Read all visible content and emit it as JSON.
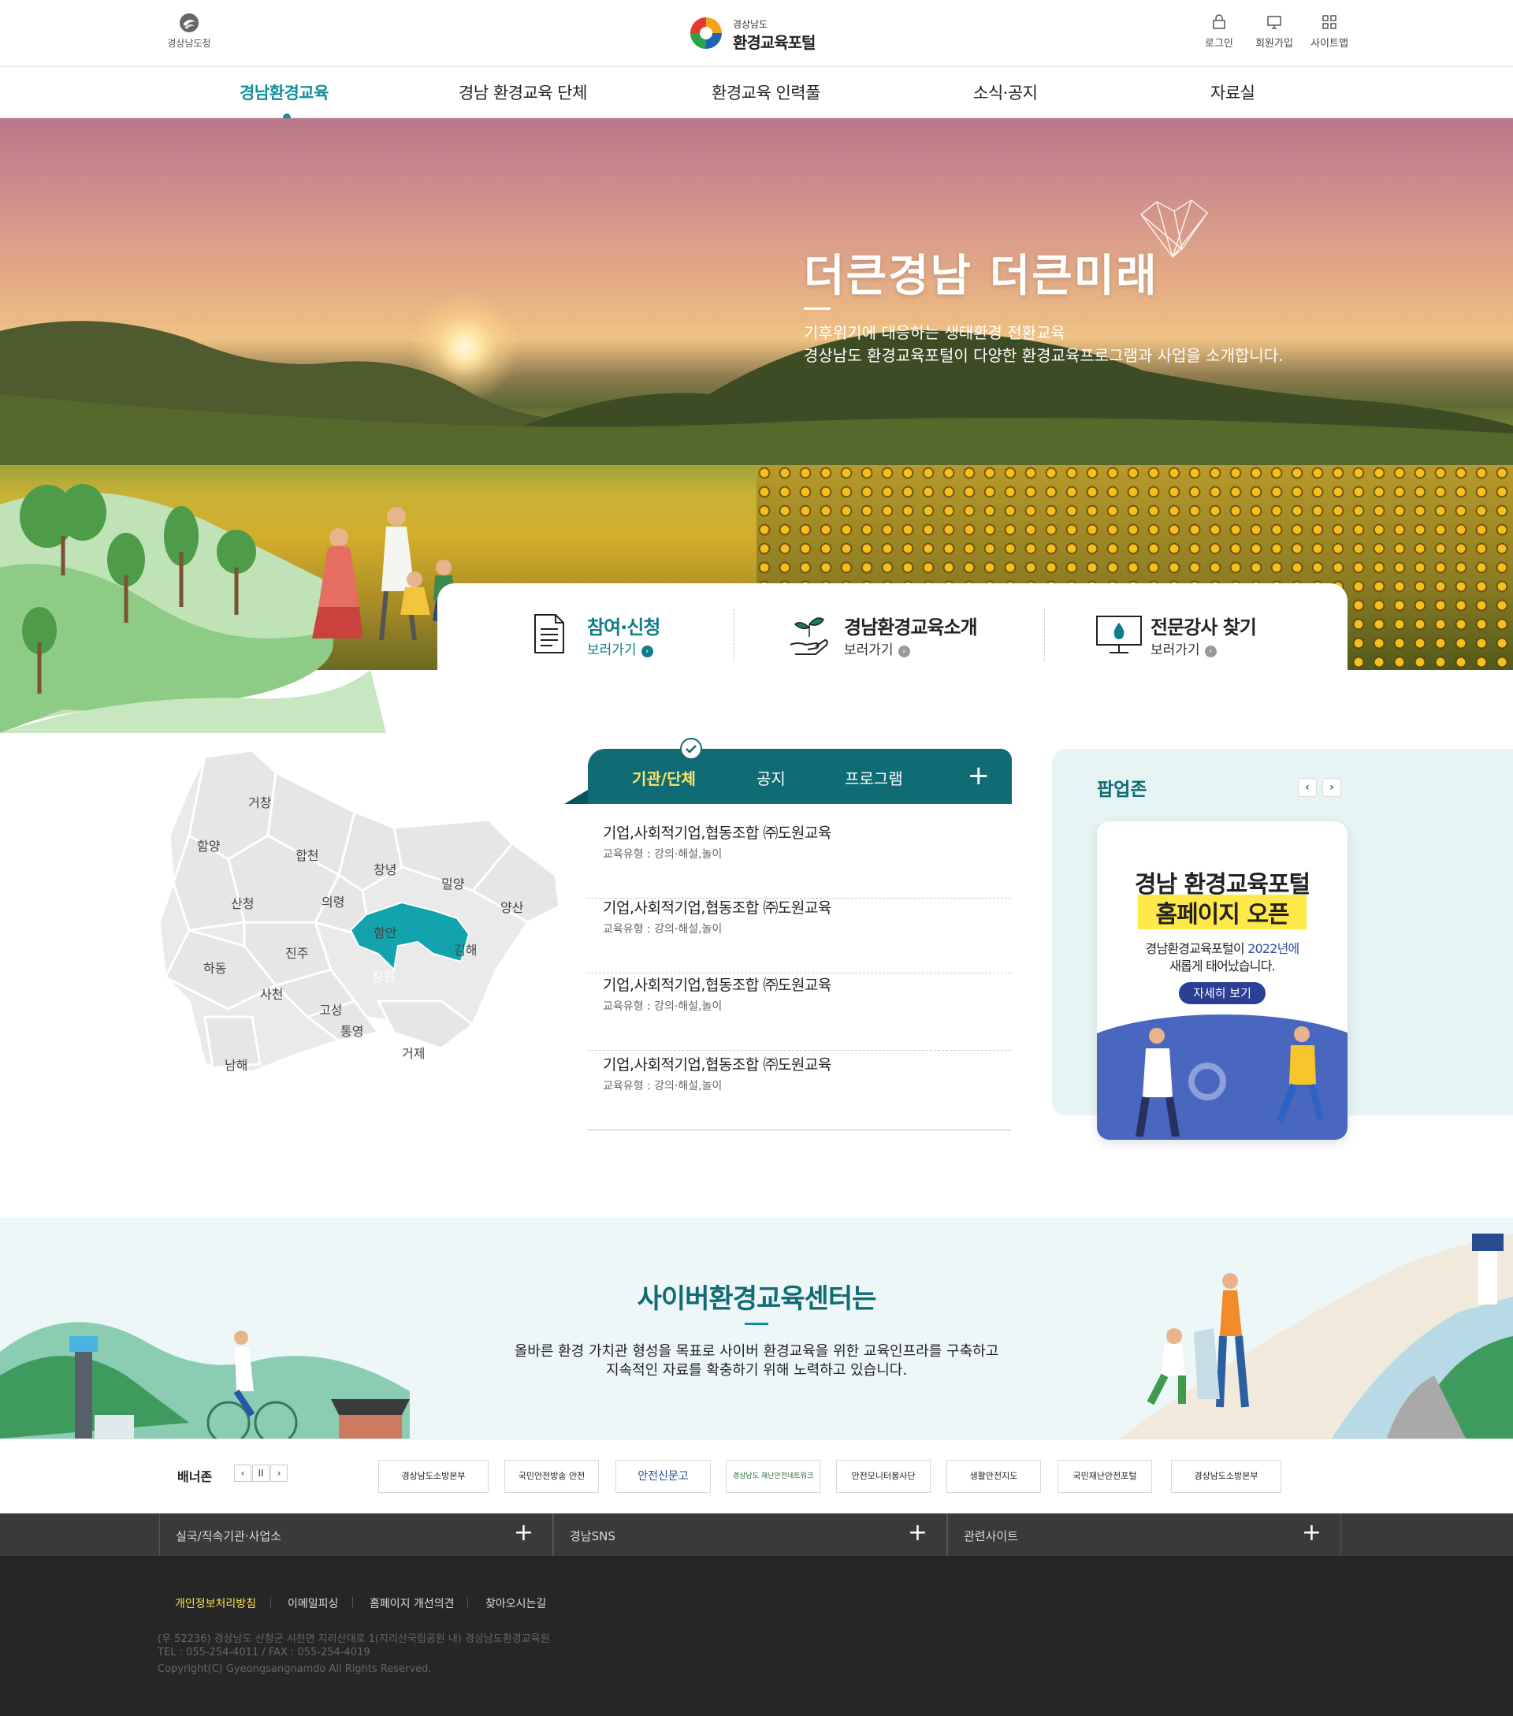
{
  "header": {
    "gov_label": "경상남도청",
    "logo_sub": "경상남도",
    "logo_main": "환경교육포털",
    "util": [
      {
        "label": "로그인",
        "icon": "lock-icon"
      },
      {
        "label": "회원가입",
        "icon": "monitor-icon"
      },
      {
        "label": "사이트맵",
        "icon": "grid-icon"
      }
    ]
  },
  "gnb": [
    "경남환경교육",
    "경남 환경교육 단체",
    "환경교육 인력풀",
    "소식·공지",
    "자료실"
  ],
  "hero": {
    "title": "더큰경남 더큰미래",
    "desc1": "기후위기에 대응하는 생태환경 전환교육",
    "desc2": "경상남도 환경교육포털이 다양한 환경교육프로그램과 사업을 소개합니다."
  },
  "quick": [
    {
      "name": "참여·신청",
      "more": "보러가기",
      "color": "#0f7d8a",
      "icon": "document-icon"
    },
    {
      "name": "경남환경교육소개",
      "more": "보러가기",
      "color": "#222222",
      "icon": "sprout-hand-icon"
    },
    {
      "name": "전문강사 찾기",
      "more": "보러가기",
      "color": "#222222",
      "icon": "monitor-drop-icon"
    }
  ],
  "map": {
    "regions": [
      "거창",
      "함양",
      "합천",
      "창녕",
      "밀양",
      "양산",
      "산청",
      "의령",
      "함안",
      "김해",
      "하동",
      "진주",
      "창원",
      "사천",
      "고성",
      "통영",
      "거제",
      "남해"
    ],
    "selected": "창원",
    "selected_color": "#13a3ad"
  },
  "tabs": {
    "items": [
      "기관/단체",
      "공지",
      "프로그램"
    ],
    "active": "기관/단체",
    "more": "+"
  },
  "posts": [
    {
      "title": "기업,사회적기업,협동조합 ㈜도원교육",
      "type": "교육유형 : 강의·해설,놀이"
    },
    {
      "title": "기업,사회적기업,협동조합 ㈜도원교육",
      "type": "교육유형 : 강의·해설,놀이"
    },
    {
      "title": "기업,사회적기업,협동조합 ㈜도원교육",
      "type": "교육유형 : 강의·해설,놀이"
    },
    {
      "title": "기업,사회적기업,협동조합 ㈜도원교육",
      "type": "교육유형 : 강의·해설,놀이"
    }
  ],
  "popupzone": {
    "title": "팝업존",
    "prev": "‹",
    "next": "›",
    "card": {
      "title1": "경남 환경교육포털",
      "title2": "홈페이지 오픈",
      "desc1_a": "경남환경교육포털이 ",
      "desc1_b": "2022년에",
      "desc2": "새롭게 태어났습니다.",
      "button": "자세히 보기"
    }
  },
  "cyber": {
    "title": "사이버환경교육센터는",
    "desc1": "올바른 환경 가치관 형성을 목표로 사이버 환경교육을 위한 교육인프라를 구축하고",
    "desc2": "지속적인 자료를 확충하기 위해 노력하고 있습니다."
  },
  "banner_zone": {
    "title": "배너존",
    "controls": [
      "‹",
      "II",
      "›"
    ],
    "banners": [
      "경상남도소방본부",
      "국민안전방송 안전",
      "안전신문고",
      "경상남도 재난안전네트워크",
      "안전모니터봉사단",
      "생활안전지도",
      "국민재난안전포털",
      "경상남도소방본부"
    ]
  },
  "sitebar": [
    {
      "label": "실국/직속기관·사업소",
      "plus": "+"
    },
    {
      "label": "경남SNS",
      "plus": "+"
    },
    {
      "label": "관련사이트",
      "plus": "+"
    }
  ],
  "footer": {
    "links": [
      "개인정보처리방침",
      "이메일피싱",
      "홈페이지 개선의견",
      "찾아오시는길"
    ],
    "address": "(우 52236) 경상남도 산청군 시천면 지리산대로 1(지리산국립공원 내) 경상남도환경교육원",
    "tel": "TEL : 055-254-4011 / FAX : 055-254-4019",
    "copyright": "Copyright(C) Gyeongsangnamdo All Rights Reserved."
  }
}
